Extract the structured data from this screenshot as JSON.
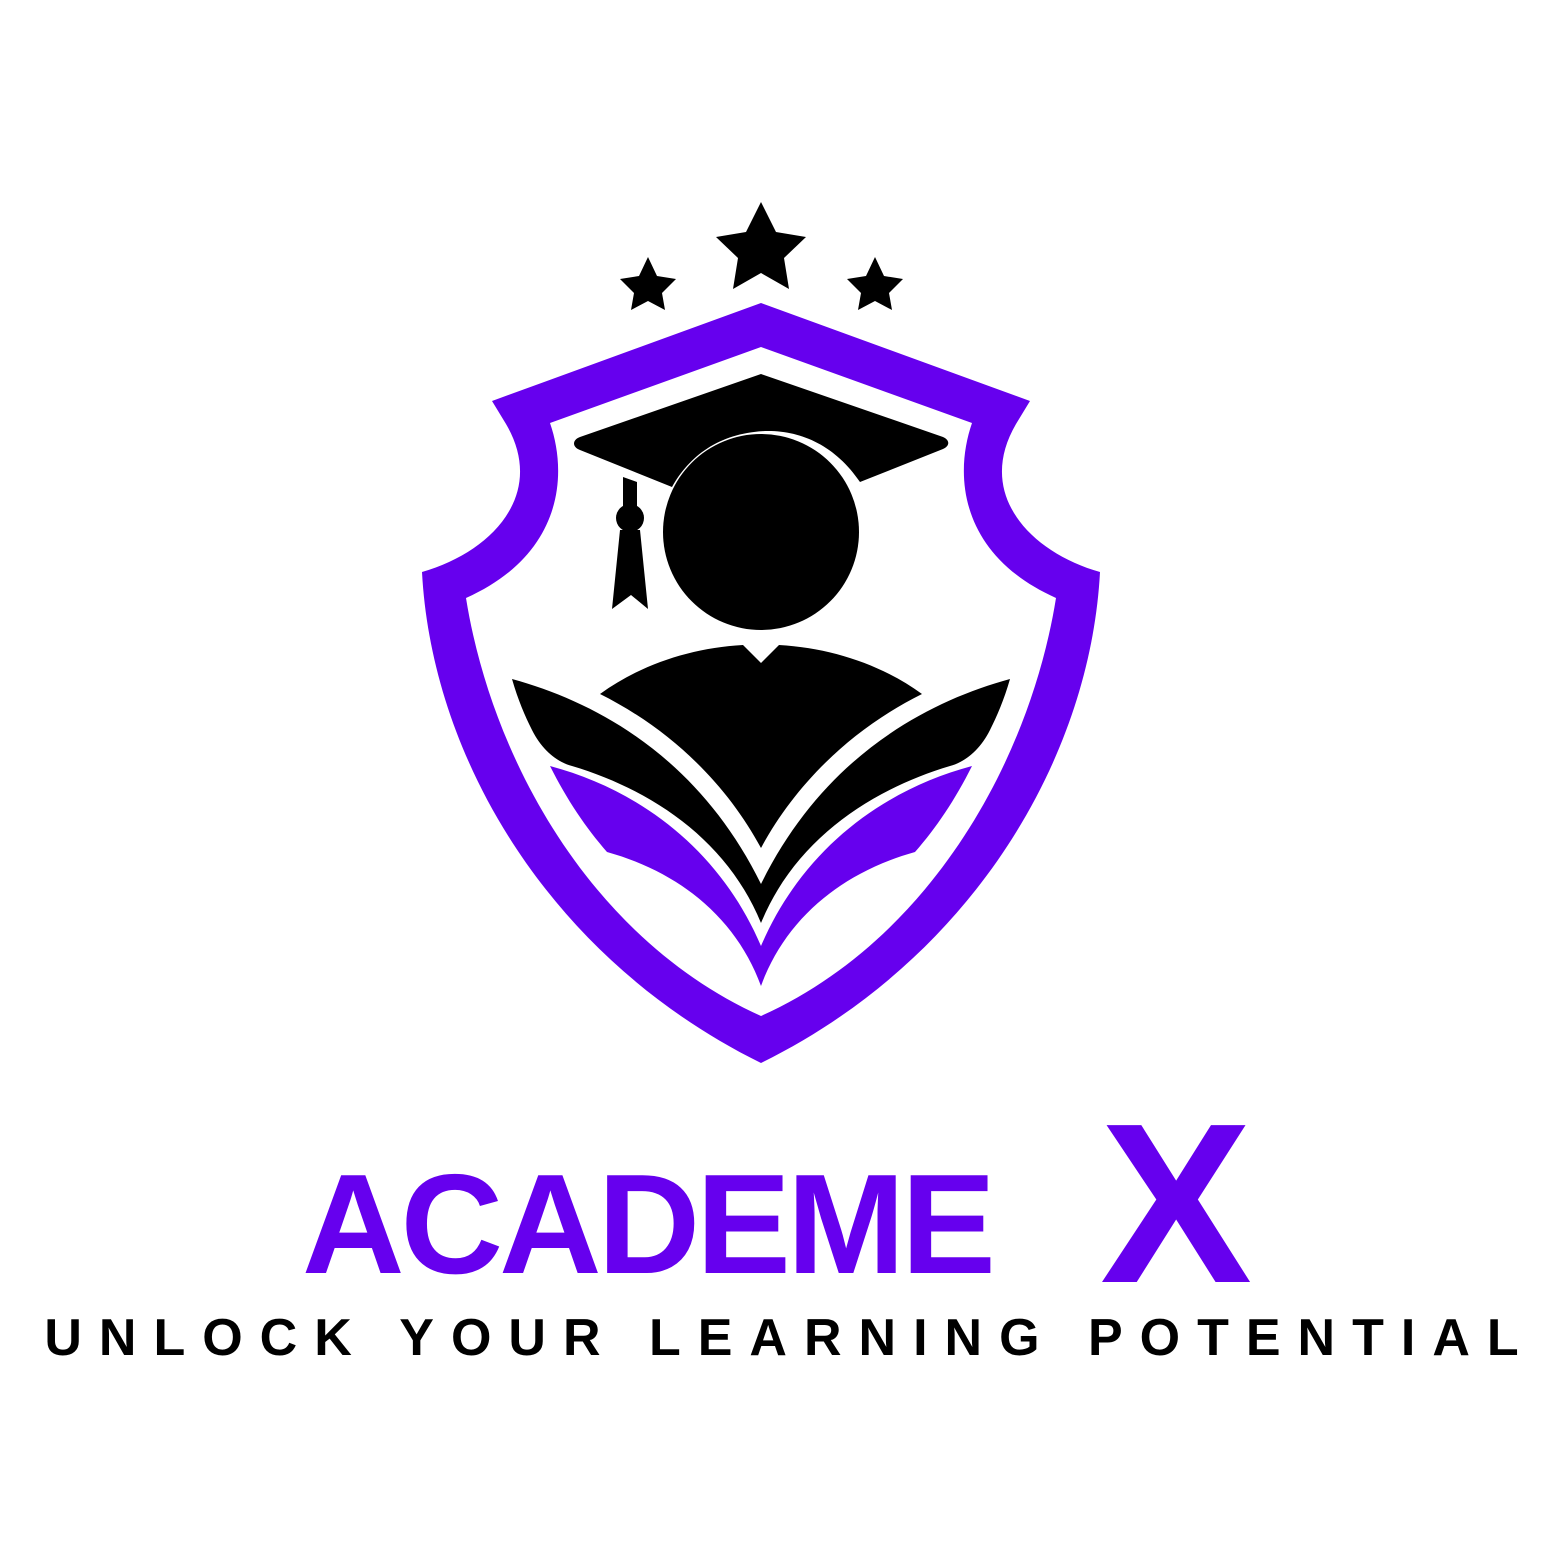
{
  "logo": {
    "brand_name": "ACADEME",
    "brand_suffix": "X",
    "tagline": "UNLOCK YOUR LEARNING POTENTIAL",
    "colors": {
      "accent": "#6600ee",
      "ink": "#000000",
      "background": "#ffffff"
    },
    "icons": [
      "star-icon",
      "star-icon",
      "star-icon",
      "shield-icon",
      "graduation-cap-icon",
      "student-head-icon",
      "open-book-icon"
    ]
  }
}
